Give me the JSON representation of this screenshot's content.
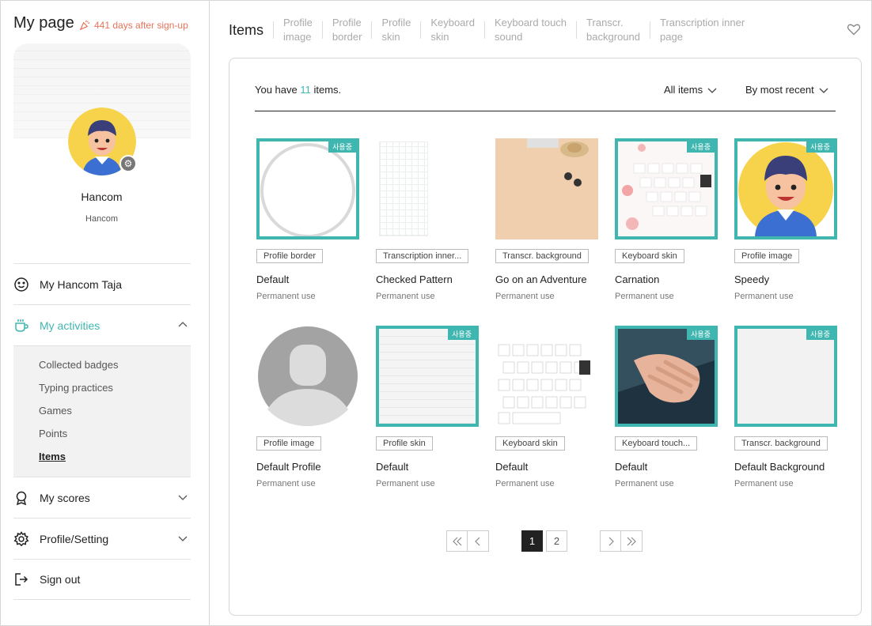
{
  "sidebar": {
    "title": "My page",
    "days": "441 days after sign-up",
    "name": "Hancom",
    "sub": "Hancom",
    "menu": [
      {
        "label": "My Hancom Taja"
      },
      {
        "label": "My activities"
      },
      {
        "label": "My scores"
      },
      {
        "label": "Profile/Setting"
      },
      {
        "label": "Sign out"
      }
    ],
    "submenu": [
      "Collected badges",
      "Typing practices",
      "Games",
      "Points",
      "Items"
    ]
  },
  "tabs": {
    "main": "Items",
    "items": [
      [
        "Profile",
        "image"
      ],
      [
        "Profile",
        "border"
      ],
      [
        "Profile",
        "skin"
      ],
      [
        "Keyboard",
        "skin"
      ],
      [
        "Keyboard touch",
        "sound"
      ],
      [
        "Transcr.",
        "background"
      ],
      [
        "Transcription inner",
        "page"
      ]
    ]
  },
  "panel": {
    "count_prefix": "You have ",
    "count": "11",
    "count_suffix": " items.",
    "filter_all": "All items",
    "filter_sort": "By most recent",
    "in_use_badge": "사용중"
  },
  "items": [
    {
      "tag": "Profile border",
      "name": "Default",
      "use": "Permanent use",
      "in_use": true
    },
    {
      "tag": "Transcription inner...",
      "name": "Checked Pattern",
      "use": "Permanent use",
      "in_use": false
    },
    {
      "tag": "Transcr. background",
      "name": "Go on an Adventure",
      "use": "Permanent use",
      "in_use": false
    },
    {
      "tag": "Keyboard skin",
      "name": "Carnation",
      "use": "Permanent use",
      "in_use": true
    },
    {
      "tag": "Profile image",
      "name": "Speedy",
      "use": "Permanent use",
      "in_use": true
    },
    {
      "tag": "Profile image",
      "name": "Default Profile",
      "use": "Permanent use",
      "in_use": false
    },
    {
      "tag": "Profile skin",
      "name": "Default",
      "use": "Permanent use",
      "in_use": true
    },
    {
      "tag": "Keyboard skin",
      "name": "Default",
      "use": "Permanent use",
      "in_use": false
    },
    {
      "tag": "Keyboard touch...",
      "name": "Default",
      "use": "Permanent use",
      "in_use": true
    },
    {
      "tag": "Transcr. background",
      "name": "Default Background",
      "use": "Permanent use",
      "in_use": true
    }
  ],
  "pagination": {
    "pages": [
      "1",
      "2"
    ],
    "current": "1"
  },
  "colors": {
    "accent": "#3fb6b0",
    "days": "#e8735a"
  }
}
